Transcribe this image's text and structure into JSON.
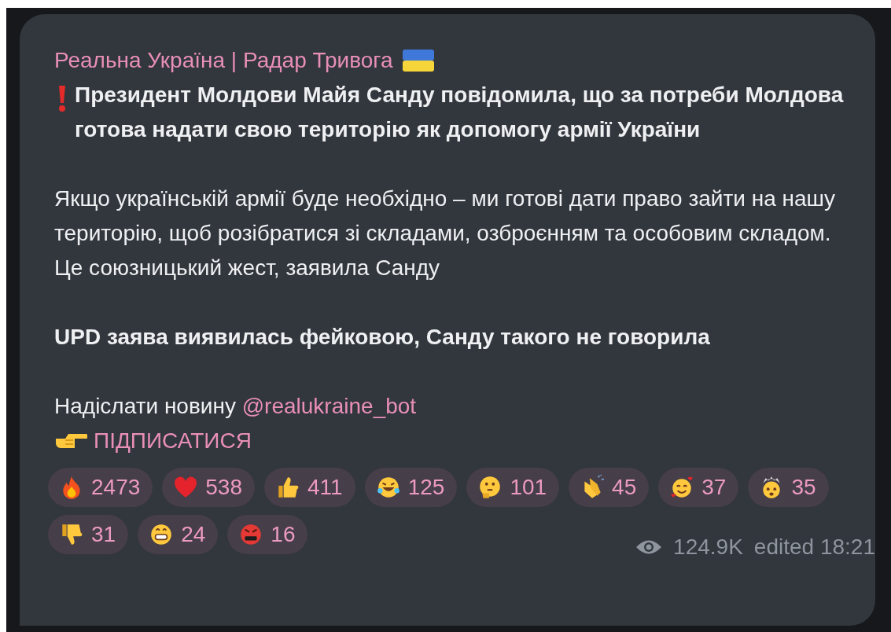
{
  "channel": {
    "title": "Реальна Україна | Радар Тривога"
  },
  "message": {
    "headline": "Президент Молдови Майя Санду повідомила, що за потреби Молдова готова надати свою територію як допомогу армії України",
    "body": "Якщо українській армії буде необхідно – ми готові дати право зайти на нашу територію, щоб розібратися зі складами, озброєнням та особовим складом. Це союзницький жест, заявила Санду",
    "update": "UPD заява виявилась фейковою, Санду такого не говорила",
    "submit": {
      "text": "Надіслати новину",
      "link": "@realukraine_bot"
    },
    "subscribe": "ПІДПИСАТИСЯ"
  },
  "reactions": [
    {
      "kind": "fire",
      "count": "2473"
    },
    {
      "kind": "heart",
      "count": "538"
    },
    {
      "kind": "thumbs-up",
      "count": "411"
    },
    {
      "kind": "laughing",
      "count": "125"
    },
    {
      "kind": "thinking",
      "count": "101"
    },
    {
      "kind": "clapping",
      "count": "45"
    },
    {
      "kind": "hearts-face",
      "count": "37"
    },
    {
      "kind": "exploding",
      "count": "35"
    },
    {
      "kind": "thumbs-down",
      "count": "31"
    },
    {
      "kind": "grin",
      "count": "24"
    },
    {
      "kind": "angry",
      "count": "16"
    }
  ],
  "footer": {
    "views": "124.9K",
    "edited": "edited 18:21"
  }
}
